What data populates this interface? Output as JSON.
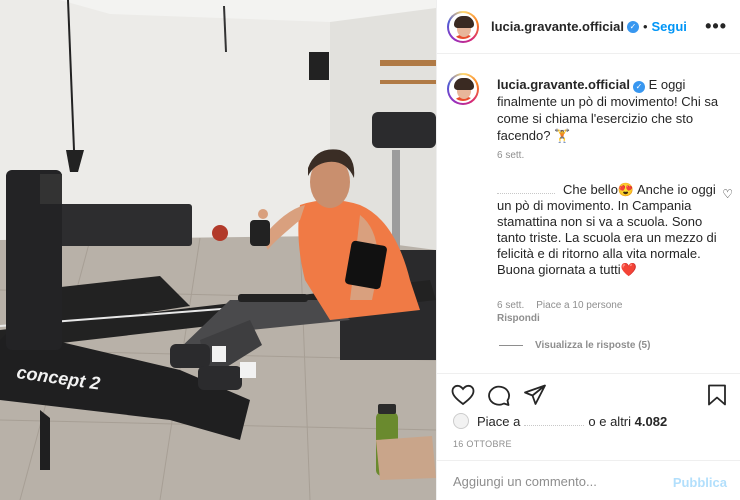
{
  "post": {
    "username": "lucia.gravante.official",
    "follow_label": "Segui",
    "dot": "•",
    "more": "•••"
  },
  "photo": {
    "rower_brand": "concept 2"
  },
  "caption": {
    "username": "lucia.gravante.official",
    "text": "E oggi finalmente un pò di movimento! Chi sa come si chiama l'esercizio che sto facendo? 🏋️",
    "time": "6 sett."
  },
  "comment": {
    "text": "Che bello😍 Anche io oggi un pò di movimento. In Campania stamattina non si va a scuola. Sono tanto triste. La scuola era un mezzo di felicità e di ritorno alla vita normale. Buona giornata a tutti❤️",
    "time": "6 sett.",
    "likes": "Piace a 10 persone",
    "reply": "Rispondi",
    "view_replies": "Visualizza le risposte (5)"
  },
  "likes": {
    "prefix": "Piace a",
    "suffix_letter": "o",
    "and": "e altri",
    "count": "4.082"
  },
  "date": "16 OTTOBRE",
  "add_comment": {
    "placeholder": "Aggiungi un commento...",
    "publish": "Pubblica"
  }
}
